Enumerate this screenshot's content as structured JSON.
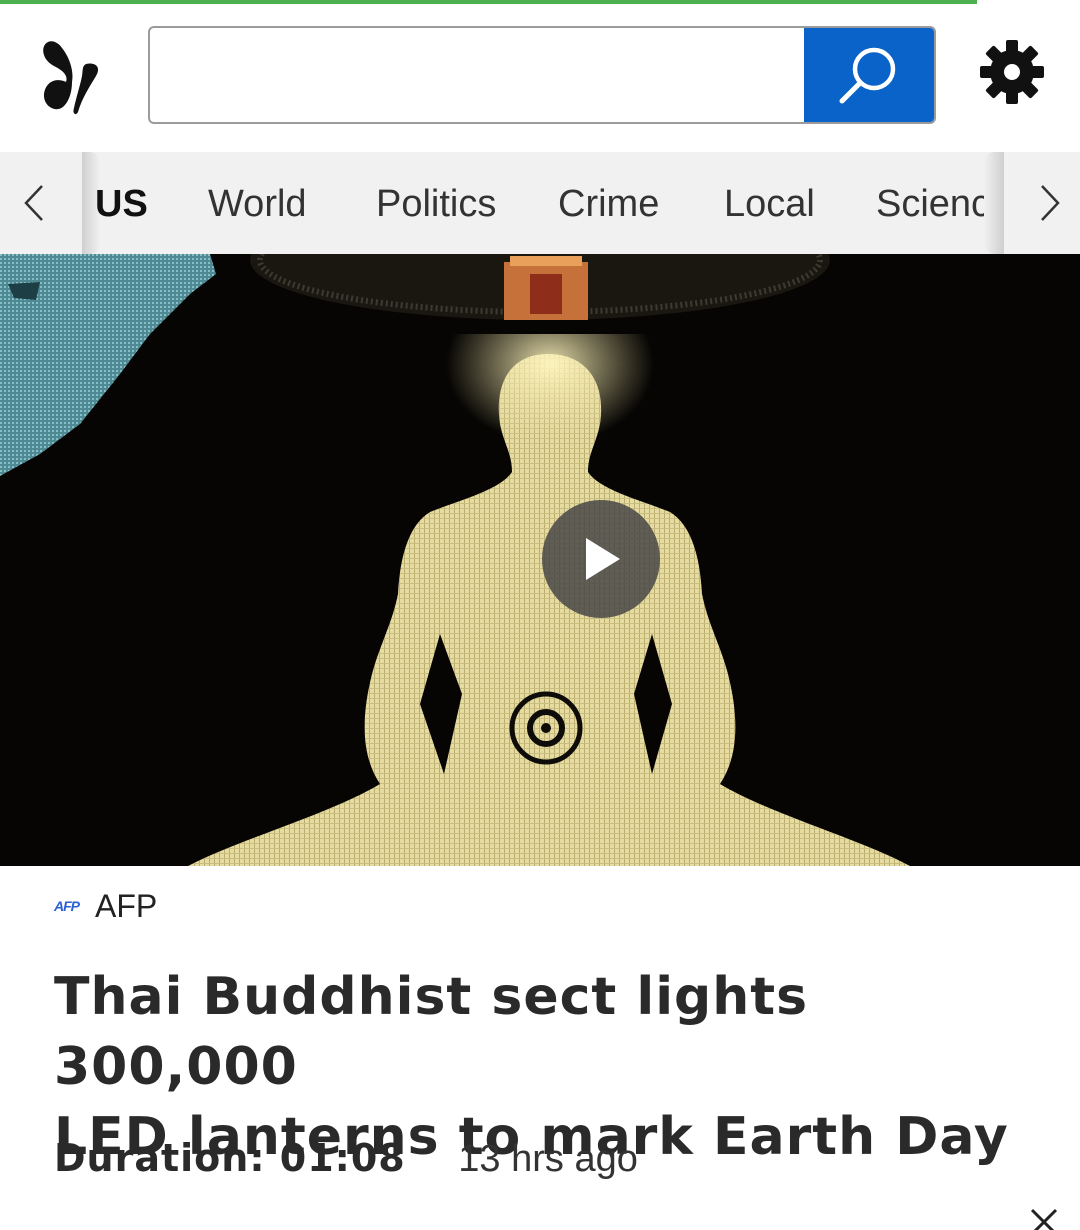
{
  "page_load_progress": 0.905,
  "search": {
    "placeholder": "",
    "value": ""
  },
  "nav": {
    "tabs": [
      {
        "label": "US",
        "active": true
      },
      {
        "label": "World",
        "active": false
      },
      {
        "label": "Politics",
        "active": false
      },
      {
        "label": "Crime",
        "active": false
      },
      {
        "label": "Local",
        "active": false
      },
      {
        "label": "Science",
        "active": false
      }
    ]
  },
  "article": {
    "source_logo": "AFP",
    "source_name": "AFP",
    "headline_line1": "Thai Buddhist sect lights 300,000",
    "headline_line2": "LED lanterns to mark Earth Day",
    "duration_label": "Duration: 01:08",
    "age": "13 hrs ago"
  },
  "icons": {
    "logo": "butterfly-logo-icon",
    "search": "search-icon",
    "settings": "gear-icon",
    "nav_left": "chevron-left-icon",
    "nav_right": "chevron-right-icon",
    "play": "play-icon",
    "close": "close-icon"
  },
  "colors": {
    "accent": "#0a63c9",
    "progress": "#4caf50",
    "nav_bg": "#f1f1f1"
  }
}
